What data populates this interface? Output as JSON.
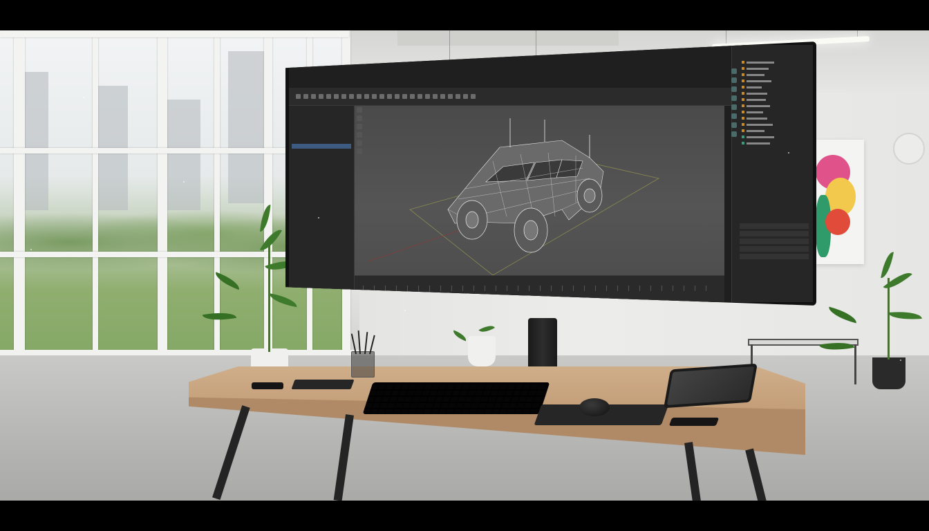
{
  "scene": {
    "description_type": "photo-of-workspace-with-curved-monitor",
    "colors": {
      "wall": "#e6e6e4",
      "floor": "#b5b5b3",
      "desk_wood": "#c9a680",
      "monitor_bezel": "#111111",
      "app_background": "#1f1f1f",
      "viewport": "#505050",
      "selection": "#3d5a80",
      "plant_leaf": "#3e7a2c",
      "art_pink": "#e0538a",
      "art_yellow": "#f2c94c",
      "art_green": "#2f9a6a",
      "art_red": "#e04b3a"
    }
  },
  "monitor": {
    "app": {
      "title": "",
      "status_text": "",
      "viewport_label": "",
      "outliner_items": [
        "",
        "",
        "",
        "",
        "",
        "",
        "",
        "",
        "",
        "",
        "",
        "",
        "",
        "",
        ""
      ],
      "selected_item_index": 7,
      "property_rows": [
        "",
        "",
        "",
        "",
        ""
      ]
    }
  }
}
